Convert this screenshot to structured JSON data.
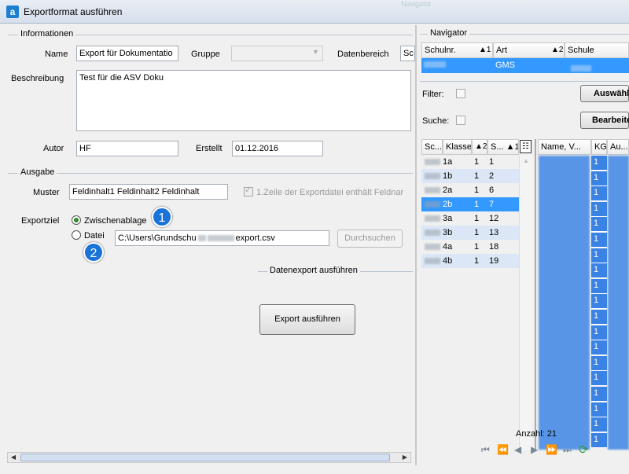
{
  "window": {
    "title": "Exportformat ausführen",
    "icon_letter": "a",
    "bg_tab": "Navigator"
  },
  "info": {
    "section": "Informationen",
    "name_label": "Name",
    "name_value": "Export für Dokumentatio",
    "gruppe_label": "Gruppe",
    "gruppe_value": "",
    "datenbereich_label": "Datenbereich",
    "datenbereich_value": "Sc",
    "beschreibung_label": "Beschreibung",
    "beschreibung_value": "Test für die ASV Doku",
    "autor_label": "Autor",
    "autor_value": "HF",
    "erstellt_label": "Erstellt",
    "erstellt_value": "01.12.2016"
  },
  "ausgabe": {
    "section": "Ausgabe",
    "muster_label": "Muster",
    "muster_value": "Feldinhalt1    Feldinhalt2    Feldinhalt",
    "header_check_label": "1.Zeile der Exportdatei enthält Feldnar",
    "exportziel_label": "Exportziel",
    "opt_clipboard": "Zwischenablage",
    "opt_file": "Datei",
    "path_prefix": "C:\\Users\\Grundschu",
    "path_suffix": "export.csv",
    "browse_button": "Durchsuchen",
    "badge1": "1",
    "badge2": "2"
  },
  "run": {
    "section": "Datenexport ausführen",
    "button": "Export ausführen"
  },
  "navigator": {
    "section": "Navigator",
    "top_headers": [
      {
        "label": "Schulnr.",
        "sort": "1"
      },
      {
        "label": "Art",
        "sort": "2"
      },
      {
        "label": "Schule",
        "sort": ""
      }
    ],
    "top_row": {
      "art": "GMS"
    },
    "filter_label": "Filter:",
    "suche_label": "Suche:",
    "auswahl_button": "Auswähl",
    "bearbeiten_button": "Bearbeite",
    "class_headers": [
      "Sc...",
      "Klasse",
      "2",
      "S...",
      "1"
    ],
    "classes": [
      {
        "klasse": "1a",
        "n": "1",
        "s": "1"
      },
      {
        "klasse": "1b",
        "n": "1",
        "s": "2"
      },
      {
        "klasse": "2a",
        "n": "1",
        "s": "6"
      },
      {
        "klasse": "2b",
        "n": "1",
        "s": "7"
      },
      {
        "klasse": "3a",
        "n": "1",
        "s": "12"
      },
      {
        "klasse": "3b",
        "n": "1",
        "s": "13"
      },
      {
        "klasse": "4a",
        "n": "1",
        "s": "18"
      },
      {
        "klasse": "4b",
        "n": "1",
        "s": "19"
      }
    ],
    "student_headers": [
      "Name, V...",
      "KG",
      "Au..."
    ],
    "kg_value": "1",
    "count_label": "Anzahl: 21"
  },
  "colors": {
    "accent": "#3399ff",
    "badge": "#1a73d8"
  }
}
